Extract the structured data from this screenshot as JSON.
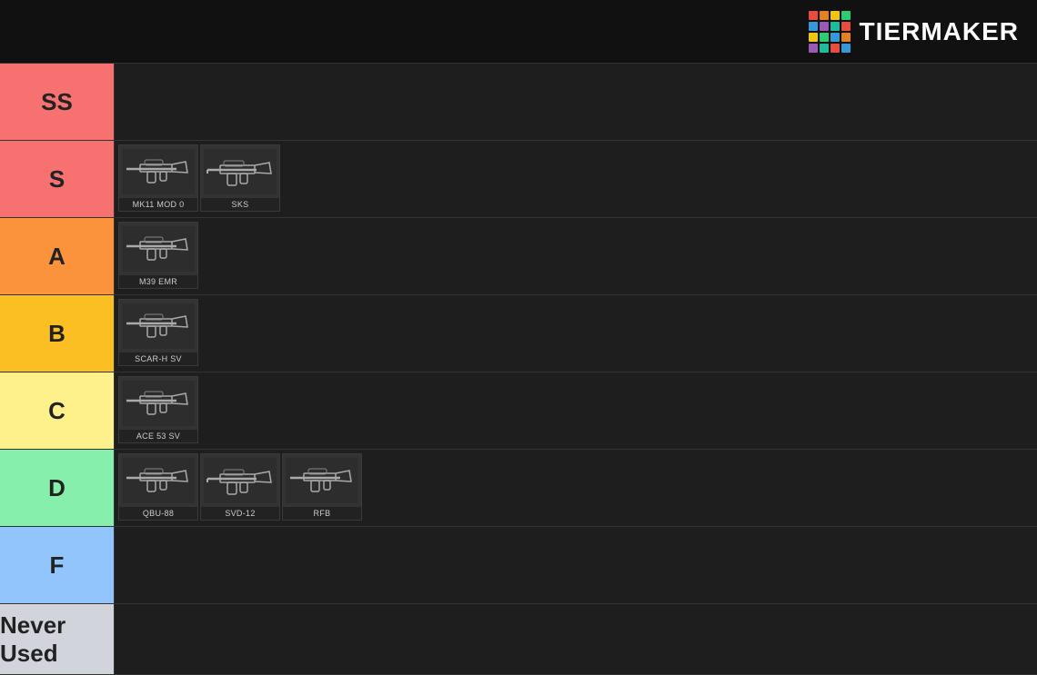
{
  "header": {
    "logo_text": "TiERMAKER",
    "logo_colors": [
      "#e74c3c",
      "#e67e22",
      "#f1c40f",
      "#2ecc71",
      "#3498db",
      "#9b59b6",
      "#1abc9c",
      "#e74c3c",
      "#f1c40f",
      "#2ecc71",
      "#3498db",
      "#e67e22",
      "#9b59b6",
      "#1abc9c",
      "#e74c3c",
      "#3498db"
    ]
  },
  "tiers": [
    {
      "id": "ss",
      "label": "SS",
      "color_class": "tier-ss",
      "weapons": []
    },
    {
      "id": "s",
      "label": "S",
      "color_class": "tier-s",
      "weapons": [
        {
          "name": "MK11 MOD 0"
        },
        {
          "name": "SKS"
        }
      ]
    },
    {
      "id": "a",
      "label": "A",
      "color_class": "tier-a",
      "weapons": [
        {
          "name": "M39 EMR"
        }
      ]
    },
    {
      "id": "b",
      "label": "B",
      "color_class": "tier-b",
      "weapons": [
        {
          "name": "SCAR-H SV"
        }
      ]
    },
    {
      "id": "c",
      "label": "C",
      "color_class": "tier-c",
      "weapons": [
        {
          "name": "ACE 53 SV"
        }
      ]
    },
    {
      "id": "d",
      "label": "D",
      "color_class": "tier-d",
      "weapons": [
        {
          "name": "QBU-88"
        },
        {
          "name": "SVD-12"
        },
        {
          "name": "RFB"
        }
      ]
    },
    {
      "id": "f",
      "label": "F",
      "color_class": "tier-f",
      "weapons": []
    },
    {
      "id": "never",
      "label": "Never Used",
      "color_class": "tier-never",
      "weapons": []
    }
  ]
}
